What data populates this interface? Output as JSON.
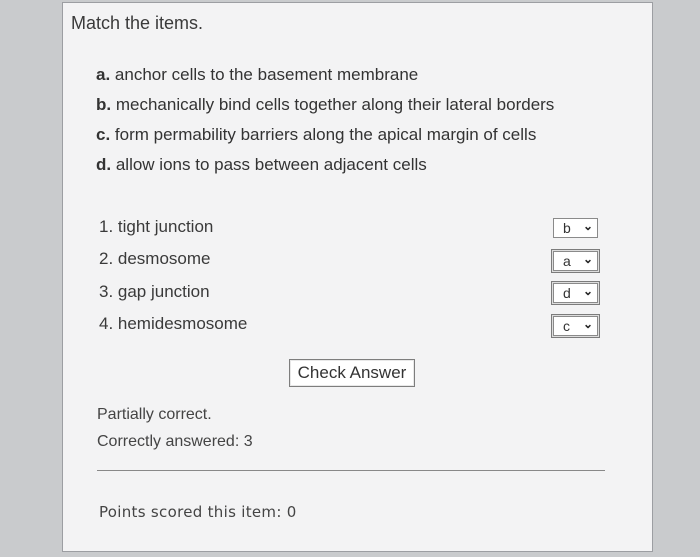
{
  "question": {
    "title": "Match the items."
  },
  "descriptions": [
    {
      "letter": "a.",
      "text": "anchor cells to the basement membrane"
    },
    {
      "letter": "b.",
      "text": "mechanically bind cells together along their lateral borders"
    },
    {
      "letter": "c.",
      "text": "form permability barriers along the apical margin of cells"
    },
    {
      "letter": "d.",
      "text": "allow ions to pass between adjacent cells"
    }
  ],
  "items": [
    {
      "label": "1. tight junction",
      "selected": "b"
    },
    {
      "label": "2. desmosome",
      "selected": "a"
    },
    {
      "label": "3. gap junction",
      "selected": "d"
    },
    {
      "label": "4. hemidesmosome",
      "selected": "c"
    }
  ],
  "actions": {
    "check_answer": "Check Answer"
  },
  "feedback": {
    "status": "Partially correct.",
    "correct_count": "Correctly answered: 3",
    "points": "Points scored this item: 0"
  },
  "icons": {
    "select_chevron": "chevron-down-icon"
  }
}
